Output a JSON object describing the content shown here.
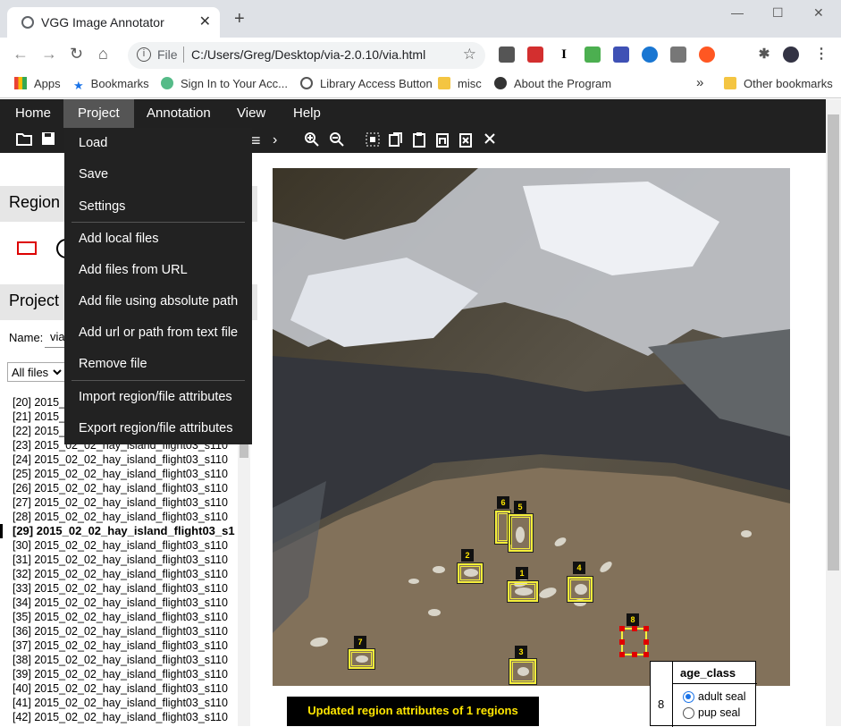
{
  "browser": {
    "tab_title": "VGG Image Annotator",
    "tab_close": "✕",
    "new_tab": "+",
    "url_scheme": "File",
    "url_path": "C:/Users/Greg/Desktop/via-2.0.10/via.html",
    "window_controls": [
      "—",
      "☐",
      "✕"
    ]
  },
  "bookmarks": [
    "Apps",
    "Bookmarks",
    "Sign In to Your Acc...",
    "Library Access Button",
    "misc",
    "About the Program"
  ],
  "bookmarks_overflow": "»",
  "other_bookmarks": "Other bookmarks",
  "menu": {
    "home": "Home",
    "project": "Project",
    "annotation": "Annotation",
    "view": "View",
    "help": "Help"
  },
  "project_menu": [
    "Load",
    "Save",
    "Settings",
    "Add local files",
    "Add files from URL",
    "Add file using absolute path",
    "Add url or path from text file",
    "Remove file",
    "Import region/file attributes",
    "Export region/file attributes"
  ],
  "left_panel": {
    "region_header": "Region",
    "project_header": "Project",
    "name_label": "Name:",
    "name_value": "via",
    "filter_value": "All files"
  },
  "file_list": [
    "[20] 2015_",
    "[21] 2015_",
    "[22] 2015_",
    "[23] 2015_02_02_hay_island_flight03_s110",
    "[24] 2015_02_02_hay_island_flight03_s110",
    "[25] 2015_02_02_hay_island_flight03_s110",
    "[26] 2015_02_02_hay_island_flight03_s110",
    "[27] 2015_02_02_hay_island_flight03_s110",
    "[28] 2015_02_02_hay_island_flight03_s110",
    "[29] 2015_02_02_hay_island_flight03_s1",
    "[30] 2015_02_02_hay_island_flight03_s110",
    "[31] 2015_02_02_hay_island_flight03_s110",
    "[32] 2015_02_02_hay_island_flight03_s110",
    "[33] 2015_02_02_hay_island_flight03_s110",
    "[34] 2015_02_02_hay_island_flight03_s110",
    "[35] 2015_02_02_hay_island_flight03_s110",
    "[36] 2015_02_02_hay_island_flight03_s110",
    "[37] 2015_02_02_hay_island_flight03_s110",
    "[38] 2015_02_02_hay_island_flight03_s110",
    "[39] 2015_02_02_hay_island_flight03_s110",
    "[40] 2015_02_02_hay_island_flight03_s110",
    "[41] 2015_02_02_hay_island_flight03_s110",
    "[42] 2015_02_02_hay_island_flight03_s110"
  ],
  "selected_file_index": 9,
  "regions": [
    "1",
    "2",
    "3",
    "4",
    "5",
    "6",
    "7",
    "8"
  ],
  "selected_region": "8",
  "status_message": "Updated region attributes of 1 regions",
  "attribute_editor": {
    "header": "age_class",
    "row_id": "8",
    "options": [
      "adult seal",
      "pup seal"
    ],
    "selected": "adult seal"
  },
  "colors": {
    "menubar": "#212121",
    "region_box": "#f5ef3a",
    "region_selected_handles": "#e00000",
    "status_text": "#ffe600"
  }
}
